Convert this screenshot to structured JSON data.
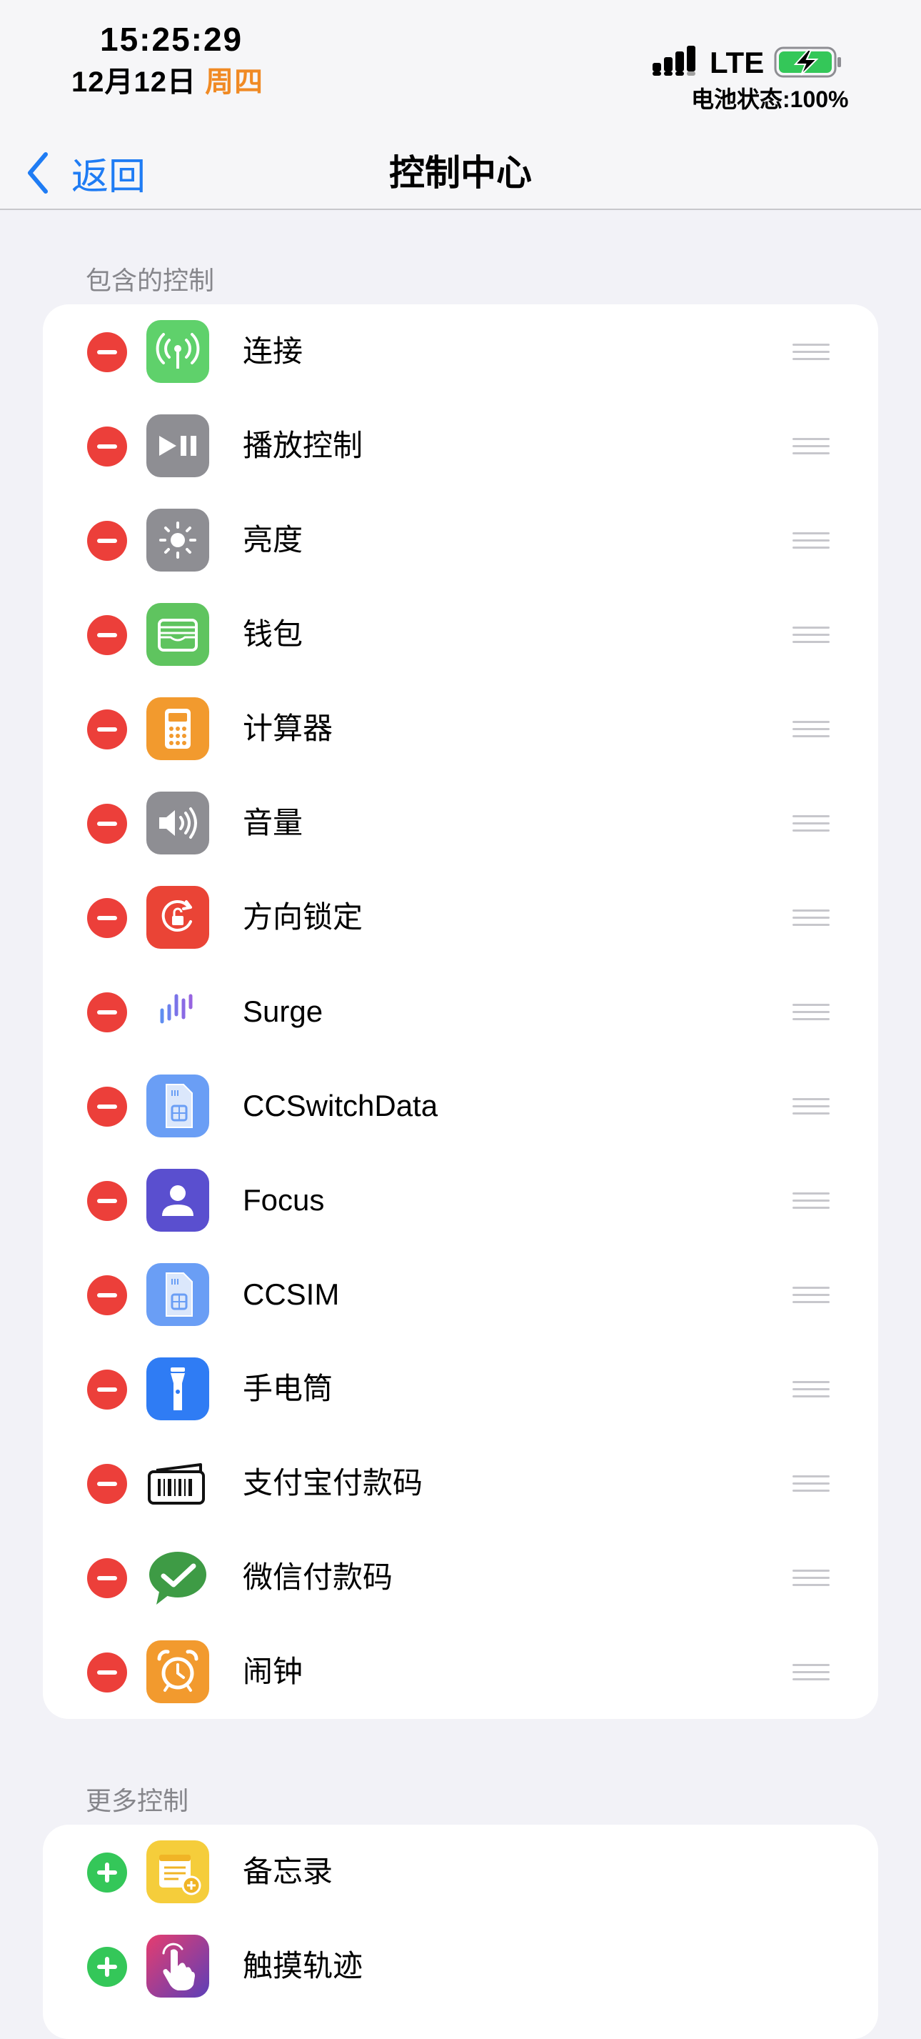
{
  "status_bar": {
    "time": "15:25:29",
    "date": "12月12日",
    "weekday": "周四",
    "network": "LTE",
    "battery_text": "电池状态:100%",
    "battery_level": 1.0,
    "weekday_color": "#f08a24"
  },
  "nav": {
    "back_label": "返回",
    "title": "控制中心",
    "accent": "#1f7cf4"
  },
  "included": {
    "header": "包含的控制",
    "items": [
      {
        "label": "连接",
        "icon": "antenna-icon"
      },
      {
        "label": "播放控制",
        "icon": "play-pause-icon"
      },
      {
        "label": "亮度",
        "icon": "sun-icon"
      },
      {
        "label": "钱包",
        "icon": "wallet-icon"
      },
      {
        "label": "计算器",
        "icon": "calculator-icon"
      },
      {
        "label": "音量",
        "icon": "speaker-icon"
      },
      {
        "label": "方向锁定",
        "icon": "rotation-lock-icon"
      },
      {
        "label": "Surge",
        "icon": "surge-wave-icon"
      },
      {
        "label": "CCSwitchData",
        "icon": "sim-card-icon"
      },
      {
        "label": "Focus",
        "icon": "person-icon"
      },
      {
        "label": "CCSIM",
        "icon": "sim-card-icon"
      },
      {
        "label": "手电筒",
        "icon": "flashlight-icon"
      },
      {
        "label": "支付宝付款码",
        "icon": "barcode-icon"
      },
      {
        "label": "微信付款码",
        "icon": "wechat-pay-icon"
      },
      {
        "label": "闹钟",
        "icon": "alarm-clock-icon"
      }
    ]
  },
  "more": {
    "header": "更多控制",
    "items": [
      {
        "label": "备忘录",
        "icon": "notes-icon"
      },
      {
        "label": "触摸轨迹",
        "icon": "touch-hand-icon"
      }
    ]
  },
  "colors": {
    "remove": "#ec3f3a",
    "add": "#34c759",
    "background": "#f2f2f7"
  }
}
